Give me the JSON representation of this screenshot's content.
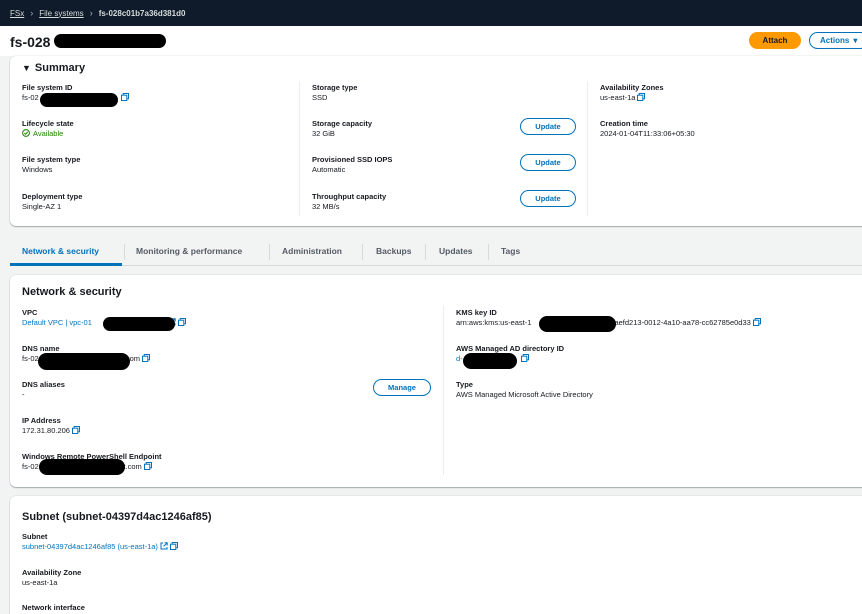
{
  "breadcrumb": {
    "root": "FSx",
    "section": "File systems",
    "current": "fs-028c01b7a36d381d0"
  },
  "header": {
    "title": "fs-028",
    "attach_label": "Attach",
    "actions_label": "Actions"
  },
  "summary": {
    "title": "Summary",
    "file_system_id": {
      "label": "File system ID",
      "value": "fs-02"
    },
    "lifecycle_state": {
      "label": "Lifecycle state",
      "value": "Available"
    },
    "file_system_type": {
      "label": "File system type",
      "value": "Windows"
    },
    "deployment_type": {
      "label": "Deployment type",
      "value": "Single-AZ 1"
    },
    "storage_type": {
      "label": "Storage type",
      "value": "SSD"
    },
    "storage_capacity": {
      "label": "Storage capacity",
      "value": "32 GiB"
    },
    "provisioned_iops": {
      "label": "Provisioned SSD IOPS",
      "value": "Automatic"
    },
    "throughput_capacity": {
      "label": "Throughput capacity",
      "value": "32 MB/s"
    },
    "availability_zones": {
      "label": "Availability Zones",
      "value": "us-east-1a"
    },
    "creation_time": {
      "label": "Creation time",
      "value": "2024-01-04T11:33:06+05:30"
    },
    "update_label": "Update"
  },
  "tabs": [
    {
      "label": "Network & security"
    },
    {
      "label": "Monitoring & performance"
    },
    {
      "label": "Administration"
    },
    {
      "label": "Backups"
    },
    {
      "label": "Updates"
    },
    {
      "label": "Tags"
    }
  ],
  "network": {
    "title": "Network & security",
    "vpc": {
      "label": "VPC",
      "value": "Default VPC | vpc-01"
    },
    "dns_name": {
      "label": "DNS name",
      "prefix": "fs-02",
      "suffix": "t.com"
    },
    "dns_aliases": {
      "label": "DNS aliases",
      "value": "-"
    },
    "manage_label": "Manage",
    "ip_address": {
      "label": "IP Address",
      "value": "172.31.80.206"
    },
    "powershell": {
      "label": "Windows Remote PowerShell Endpoint",
      "prefix": "fs-02",
      "suffix": "st.com"
    },
    "kms_key": {
      "label": "KMS key ID",
      "prefix": "arn:aws:kms:us-east-1",
      "suffix": "y/5aefd213-0012-4a10-aa78-cc62785e0d33"
    },
    "ad_directory": {
      "label": "AWS Managed AD directory ID",
      "value": "d-"
    },
    "type": {
      "label": "Type",
      "value": "AWS Managed Microsoft Active Directory"
    }
  },
  "subnet": {
    "title": "Subnet (subnet-04397d4ac1246af85)",
    "subnet": {
      "label": "Subnet",
      "value": "subnet-04397d4ac1246af85 (us-east-1a)"
    },
    "availability_zone": {
      "label": "Availability Zone",
      "value": "us-east-1a"
    },
    "network_interface": {
      "label": "Network interface"
    }
  },
  "colors": {
    "link": "#0073bb",
    "primary_button": "#ff9900",
    "success": "#1d8102",
    "topbar": "#0f1b2a"
  }
}
